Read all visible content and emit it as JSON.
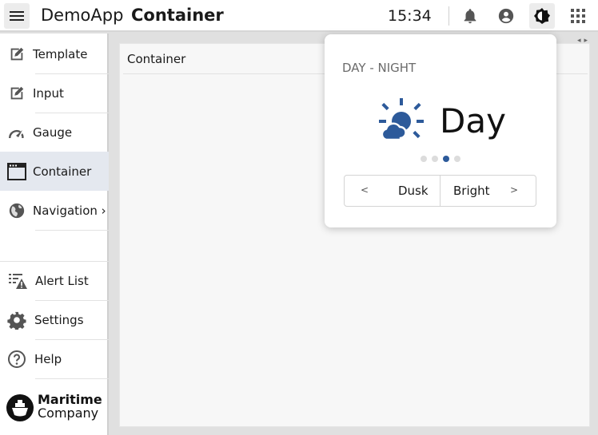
{
  "topbar": {
    "app_name": "DemoApp",
    "page_name": "Container",
    "clock": "15:34",
    "icons": [
      "menu-icon",
      "bell-icon",
      "account-icon",
      "brightness-icon",
      "apps-grid-icon"
    ]
  },
  "sidebar": {
    "items": [
      {
        "label": "Template",
        "icon": "edit-icon"
      },
      {
        "label": "Input",
        "icon": "edit-icon"
      },
      {
        "label": "Gauge",
        "icon": "gauge-icon"
      },
      {
        "label": "Container",
        "icon": "window-icon"
      },
      {
        "label": "Navigation ›",
        "icon": "globe-icon"
      }
    ],
    "bottom_items": [
      {
        "label": "Alert List",
        "icon": "alert-list-icon"
      },
      {
        "label": "Settings",
        "icon": "gear-icon"
      },
      {
        "label": "Help",
        "icon": "help-icon"
      }
    ],
    "selected": "Container",
    "logo": {
      "line1": "Maritime",
      "line2": "Company"
    }
  },
  "main": {
    "card_title": "Container"
  },
  "popover": {
    "title": "DAY - NIGHT",
    "mode": "Day",
    "mode_icon": "day-weather-icon",
    "dot_count": 4,
    "active_dot": 3,
    "prev_label": "<",
    "prev_mode": "Dusk",
    "next_mode": "Bright",
    "next_label": ">"
  },
  "colors": {
    "accent": "#2d5a9a",
    "selected_bg": "#e4e8ef",
    "topbar_bg": "#ffffff",
    "content_bg": "#f7f7f7"
  }
}
